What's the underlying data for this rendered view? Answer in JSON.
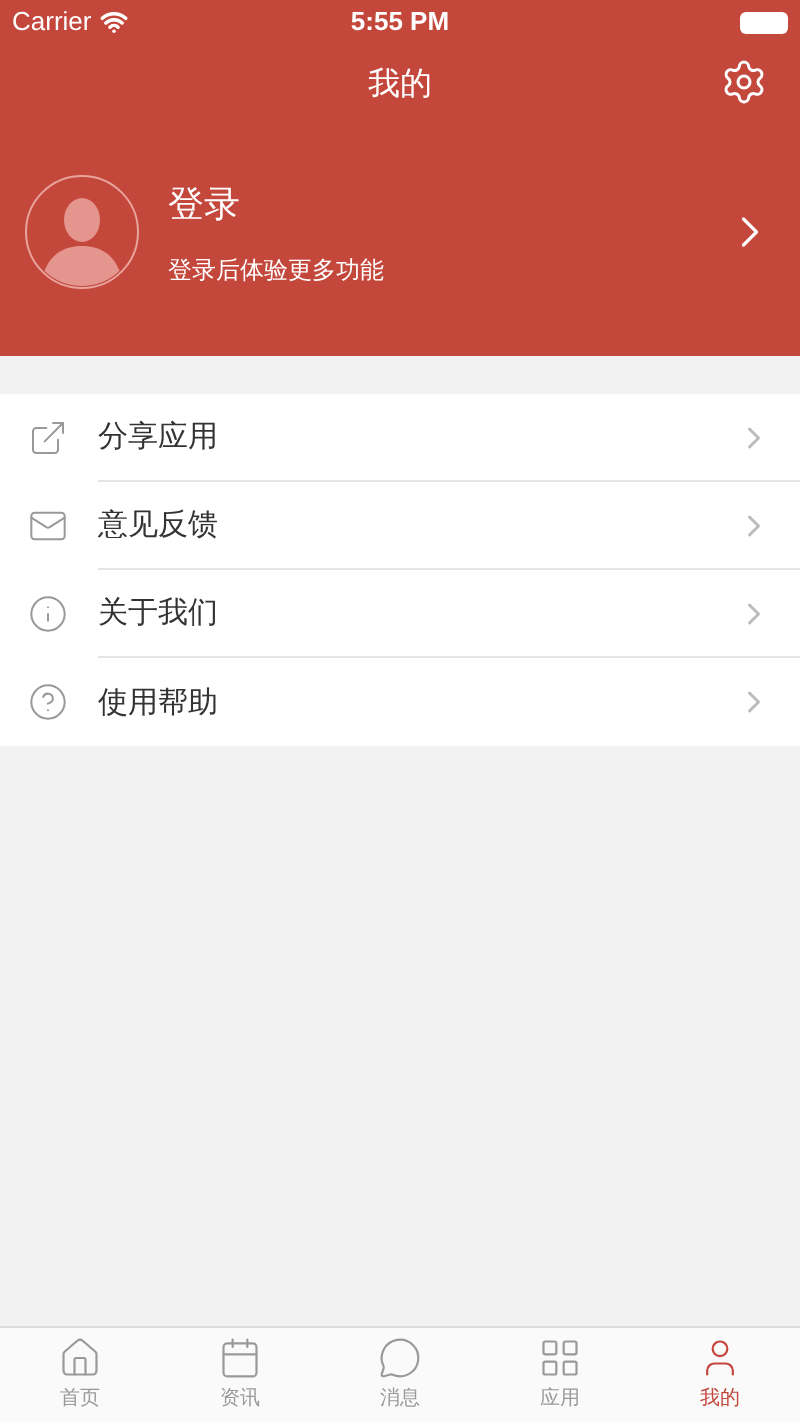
{
  "status_bar": {
    "carrier": "Carrier",
    "time": "5:55 PM"
  },
  "nav": {
    "title": "我的"
  },
  "profile": {
    "name": "登录",
    "subtitle": "登录后体验更多功能"
  },
  "menu": [
    {
      "kind": "share",
      "label": "分享应用"
    },
    {
      "kind": "feedback",
      "label": "意见反馈"
    },
    {
      "kind": "about",
      "label": "关于我们"
    },
    {
      "kind": "help",
      "label": "使用帮助"
    }
  ],
  "tabs": [
    {
      "kind": "home",
      "label": "首页",
      "selected": false
    },
    {
      "kind": "news",
      "label": "资讯",
      "selected": false
    },
    {
      "kind": "message",
      "label": "消息",
      "selected": false
    },
    {
      "kind": "apps",
      "label": "应用",
      "selected": false
    },
    {
      "kind": "me",
      "label": "我的",
      "selected": true
    }
  ]
}
